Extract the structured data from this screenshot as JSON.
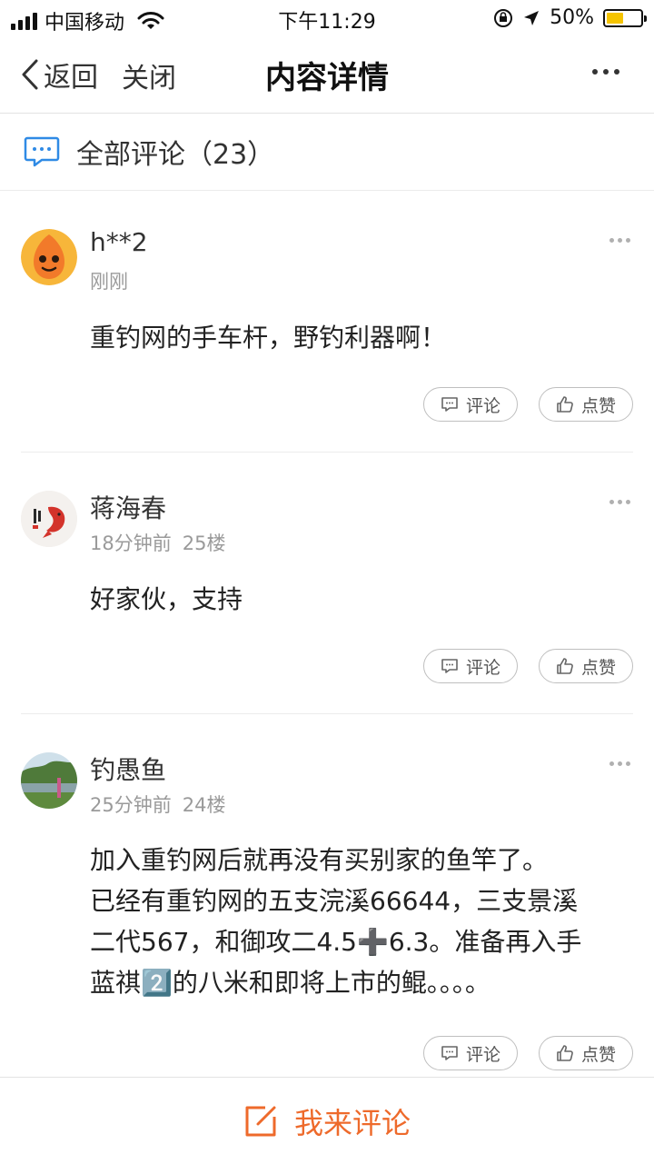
{
  "status_bar": {
    "carrier": "中国移动",
    "time": "下午11:29",
    "battery": "50%",
    "battery_level": 0.5
  },
  "nav": {
    "back_label": "返回",
    "close_label": "关闭",
    "title": "内容详情"
  },
  "section": {
    "label": "全部评论（23）"
  },
  "comments": [
    {
      "name": "h**2",
      "time": "刚刚",
      "floor": "",
      "text": "重钓网的手车杆，野钓利器啊！",
      "comment_label": "评论",
      "like_label": "点赞"
    },
    {
      "name": "蒋海春",
      "time": "18分钟前",
      "floor": "25楼",
      "text": "好家伙，支持",
      "comment_label": "评论",
      "like_label": "点赞"
    },
    {
      "name": "钓愚鱼",
      "time": "25分钟前",
      "floor": "24楼",
      "text_lines": [
        "加入重钓网后就再没有买别家的鱼竿了。",
        "已经有重钓网的五支浣溪66644，三支景溪",
        "二代567，和御攻二4.5➕6.3。准备再入手",
        "蓝祺2️⃣的八米和即将上市的鲲。。。。"
      ],
      "comment_label": "评论",
      "like_label": "点赞"
    }
  ],
  "bottom": {
    "label": "我来评论"
  },
  "colors": {
    "accent": "#ee6a2b",
    "chat_icon": "#2f8ae5",
    "battery_fill": "#f5c400"
  }
}
